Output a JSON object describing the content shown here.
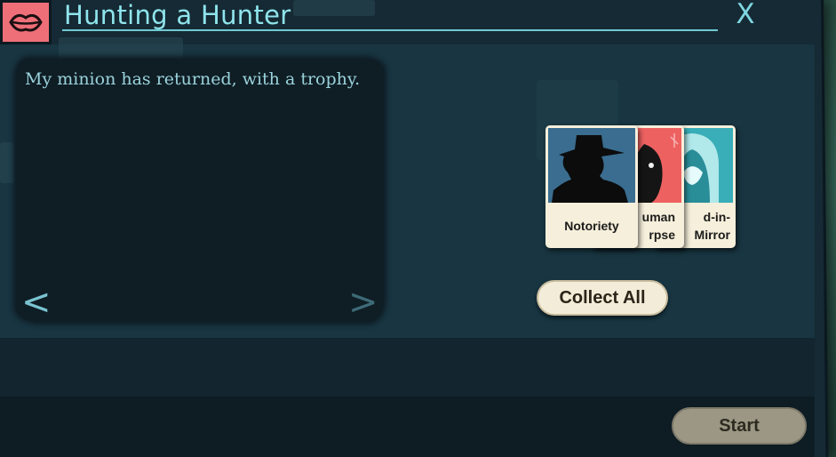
{
  "dialog": {
    "title": "Hunting a Hunter",
    "close_label": "X",
    "header_icon": "lips-icon"
  },
  "story": {
    "text": "My minion has returned, with a trophy.",
    "prev_label": "<",
    "next_label": ">"
  },
  "cards": [
    {
      "label": "Notoriety",
      "icon": "silhouette-hat-icon"
    },
    {
      "label": "uman\nrpse",
      "icon": "corpse-face-icon"
    },
    {
      "label": "d-in-\nMirror",
      "icon": "mirror-face-icon"
    }
  ],
  "actions": {
    "collect_all_label": "Collect All",
    "start_label": "Start"
  },
  "colors": {
    "accent_teal": "#8fe4ec",
    "header_icon_bg": "#ef6f78",
    "card_bg": "#f6efdb"
  }
}
